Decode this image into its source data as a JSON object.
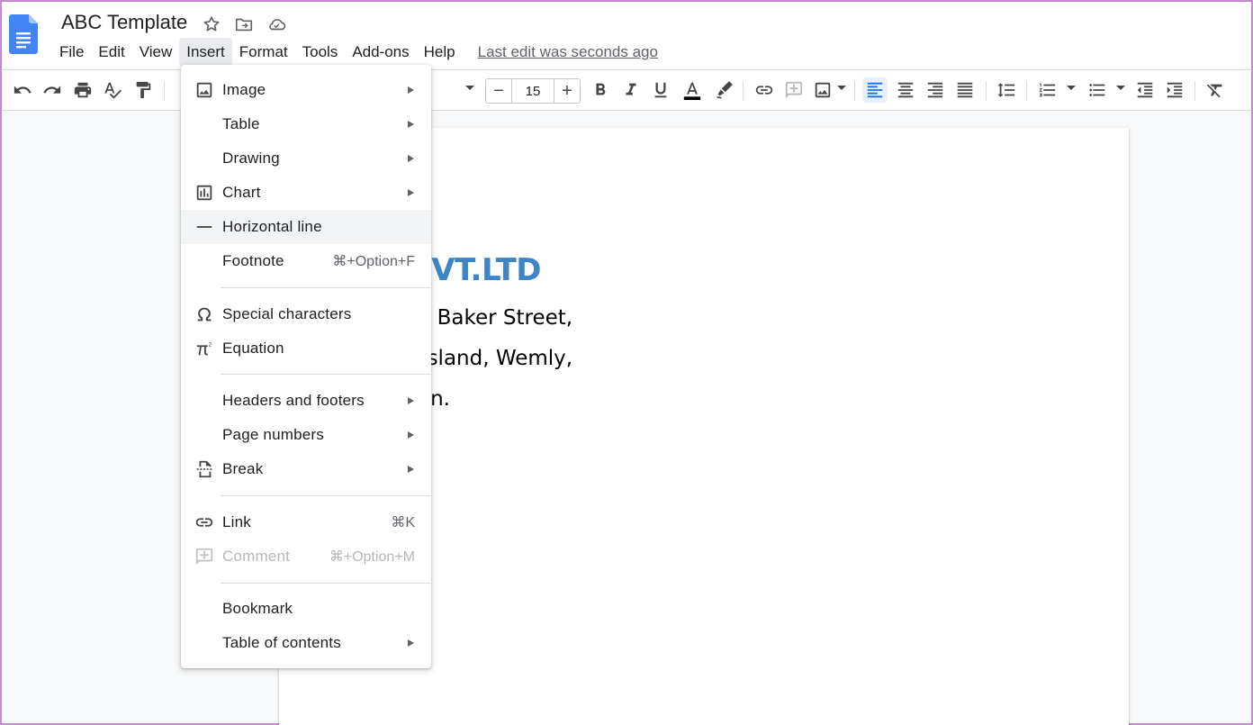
{
  "doc": {
    "title": "ABC Template"
  },
  "menubar": {
    "items": [
      "File",
      "Edit",
      "View",
      "Insert",
      "Format",
      "Tools",
      "Add-ons",
      "Help"
    ],
    "active": "Insert",
    "last_edit": "Last edit was seconds ago"
  },
  "toolbar": {
    "font_size": "15",
    "minus": "−",
    "plus": "+"
  },
  "document": {
    "company": "nList PVT.LTD",
    "lines": [
      ", Baker Street,",
      "nsland, Wemly,",
      "on."
    ]
  },
  "insert_menu": {
    "items": [
      {
        "label": "Image",
        "icon": "image-icon",
        "submenu": true
      },
      {
        "label": "Table",
        "icon": "",
        "submenu": true
      },
      {
        "label": "Drawing",
        "icon": "",
        "submenu": true
      },
      {
        "label": "Chart",
        "icon": "chart-icon",
        "submenu": true
      },
      {
        "label": "Horizontal line",
        "icon": "horizontal-line-icon",
        "submenu": false
      },
      {
        "label": "Footnote",
        "icon": "",
        "shortcut": "⌘+Option+F"
      },
      {
        "label": "Special characters",
        "icon": "omega-icon"
      },
      {
        "label": "Equation",
        "icon": "pi-icon"
      },
      {
        "label": "Headers and footers",
        "icon": "",
        "submenu": true
      },
      {
        "label": "Page numbers",
        "icon": "",
        "submenu": true
      },
      {
        "label": "Break",
        "icon": "page-break-icon",
        "submenu": true
      },
      {
        "label": "Link",
        "icon": "link-icon",
        "shortcut": "⌘K"
      },
      {
        "label": "Comment",
        "icon": "add-comment-icon",
        "shortcut": "⌘+Option+M",
        "disabled": true
      },
      {
        "label": "Bookmark",
        "icon": ""
      },
      {
        "label": "Table of contents",
        "icon": "",
        "submenu": true
      }
    ],
    "highlighted": "Horizontal line"
  },
  "colors": {
    "accent": "#1a73e8",
    "heading": "#3d85c6"
  }
}
